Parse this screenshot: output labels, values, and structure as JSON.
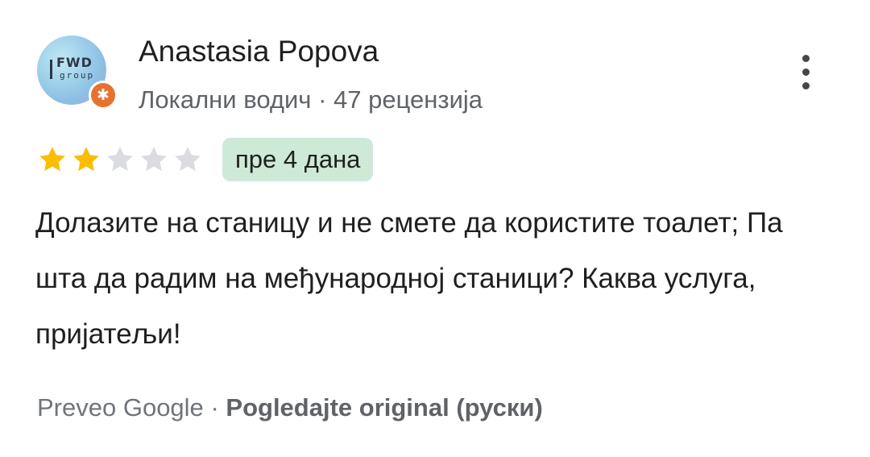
{
  "review": {
    "author": {
      "name": "Anastasia Popova",
      "avatar_logo_text": "FWD",
      "avatar_logo_subtext": "group",
      "badge_icon": "star-icon",
      "level": "Локални водич",
      "separator": "·",
      "review_count": "47 рецензија"
    },
    "menu_icon": "more-vert-icon",
    "rating": {
      "value": 2,
      "max": 5,
      "filled_color": "#fbbc04",
      "empty_color": "#dadce0"
    },
    "time_chip": {
      "label": "пре 4 дана",
      "color": "#ceead6"
    },
    "text": "Долазите на станицу и не смете да користите тоалет; Па шта да радим на међународној станици? Каква услуга, пријатељи!",
    "translation": {
      "translated_by": "Preveo Google",
      "separator": "·",
      "view_original": "Pogledajte original (руски)"
    },
    "colors": {
      "guide_badge": "#e8712f",
      "secondary_text": "#5f6368"
    }
  }
}
